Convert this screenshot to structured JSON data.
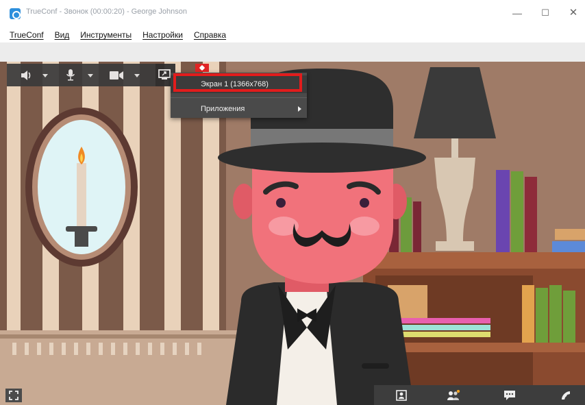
{
  "window": {
    "title": "TrueConf - Звонок (00:00:20) - George Johnson",
    "minimize_glyph": "—",
    "maximize_glyph": "☐",
    "close_glyph": "✕"
  },
  "menu": {
    "items": [
      "TrueConf",
      "Вид",
      "Инструменты",
      "Настройки",
      "Справка"
    ]
  },
  "toolbar": {
    "icons": [
      "speaker-icon",
      "microphone-icon",
      "camera-icon",
      "screen-share-icon"
    ]
  },
  "share_menu": {
    "screen_item": "Экран 1 (1366x768)",
    "apps_item": "Приложения"
  },
  "bottom_bar": {
    "icons": [
      "self-view-icon",
      "participants-icon",
      "chat-icon",
      "end-call-icon"
    ]
  },
  "colors": {
    "accent": "#2d8fdc",
    "highlight": "#e21c1c",
    "toolbar_bg": "#3a3a3a",
    "wall_stripe_light": "#f2ddc5",
    "wall_stripe_dark": "#7b5a49",
    "skin": "#f1727b",
    "hat": "#2e2e2e"
  }
}
